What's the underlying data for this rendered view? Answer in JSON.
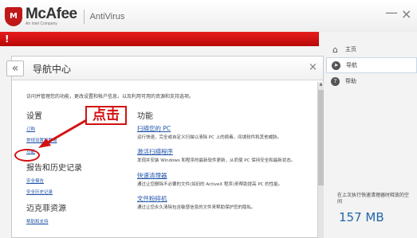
{
  "app": {
    "brand": "McAfee",
    "brand_sub": "An Intel Company",
    "product": "AntiVirus",
    "minimize": "—",
    "close": "×"
  },
  "alert": {
    "text": "!"
  },
  "right_nav": {
    "items": [
      {
        "label": "主页",
        "icon": "home-icon"
      },
      {
        "label": "导航",
        "icon": "compass-icon"
      },
      {
        "label": "帮助",
        "icon": "help-icon"
      }
    ],
    "status_label": "在上次执行快速清理器时释放的空间",
    "status_value": "157 MB"
  },
  "panel": {
    "back": "«",
    "title": "导航中心",
    "close": "×",
    "intro": "访问并管理您的功能，更改设置和帐户信息，以及利用可用的资源和支持选项。",
    "settings": {
      "heading": "设置",
      "links": [
        "订购",
        "常规设置和警报",
        "功能"
      ]
    },
    "reports": {
      "heading": "报告和历史记录",
      "links": [
        "安全报告",
        "安全历史记录"
      ]
    },
    "resources": {
      "heading": "迈克菲资源",
      "links": [
        "帮助和支持"
      ]
    },
    "features": {
      "heading": "功能",
      "items": [
        {
          "title": "扫描您的 PC",
          "desc": "运行快速，完全或自定义扫描以清除 PC 上的病毒，间谍软件和其他威胁。"
        },
        {
          "title": "激活扫描程序",
          "desc": "发现并安装 Windows 和程序的最新软件更新，从而使 PC 保持安全和最新状态。"
        },
        {
          "title": "快速清理器",
          "desc": "通过让您删除不必要的文件(如旧的 ActiveX 程序)来帮助提高 PC 的性能。"
        },
        {
          "title": "文件粉碎机",
          "desc": "通过让您永久清除包含敏感信息的文件来帮助保护您的隐私。"
        }
      ]
    }
  },
  "annotation": {
    "callout": "点击",
    "color": "#d31010"
  },
  "colors": {
    "alert_red": "#d31010",
    "link_blue": "#2255aa"
  }
}
